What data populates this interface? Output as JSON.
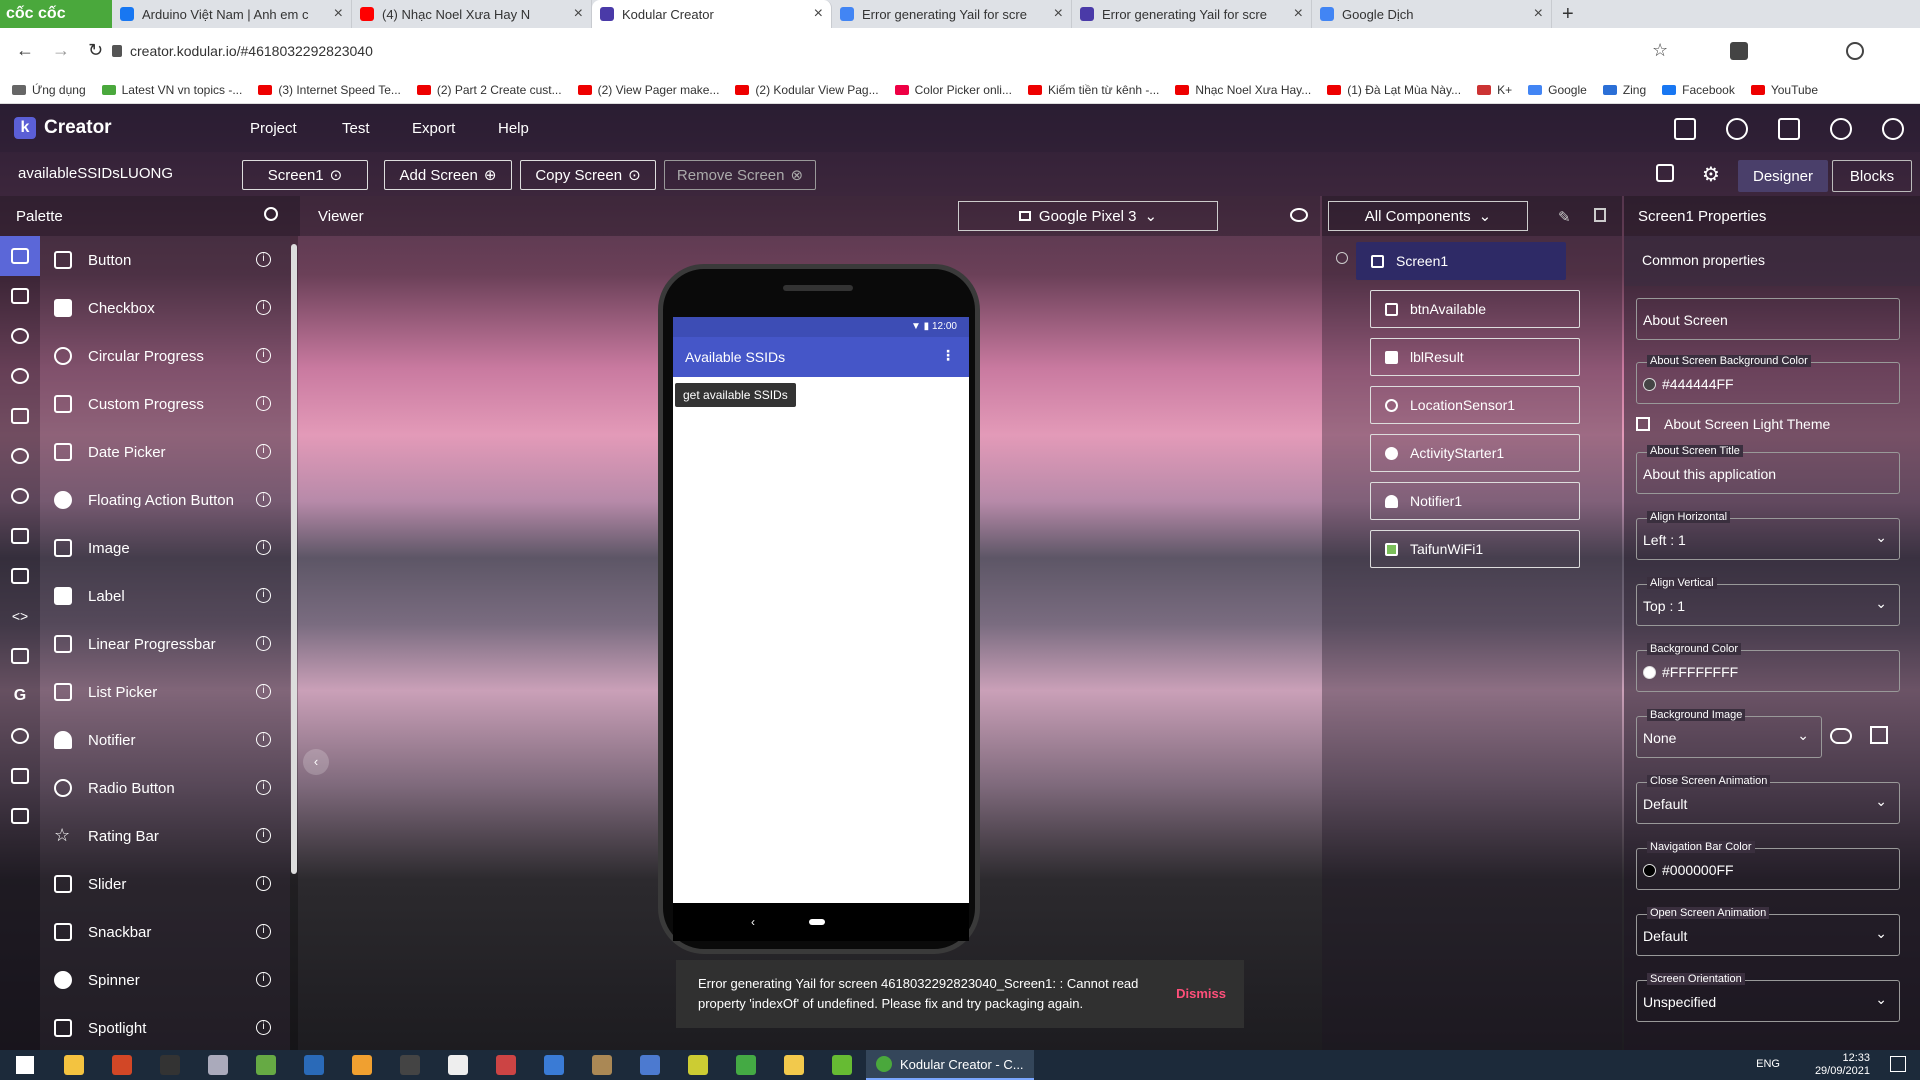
{
  "browser": {
    "brand": "cốc cốc",
    "tabs": [
      {
        "title": "Arduino Việt Nam | Anh em c",
        "favicon_color": "#1877f2"
      },
      {
        "title": "(4) Nhạc Noel Xưa Hay N",
        "favicon_color": "#ff0000"
      },
      {
        "title": "Kodular Creator",
        "favicon_color": "#4a3aa8"
      },
      {
        "title": "Error generating Yail for scre",
        "favicon_color": "#4285f4"
      },
      {
        "title": "Error generating Yail for scre",
        "favicon_color": "#4a3aa8"
      },
      {
        "title": "Google Dịch",
        "favicon_color": "#4285f4"
      }
    ],
    "url": "creator.kodular.io/#4618032292823040",
    "bookmarks": [
      "Ứng dụng",
      "Latest VN vn topics -...",
      "(3) Internet Speed Te...",
      "(2) Part 2 Create cust...",
      "(2) View Pager make...",
      "(2) Kodular View Pag...",
      "Color Picker onli...",
      "Kiếm tiền từ kênh -...",
      "Nhạc Noel Xưa Hay...",
      "(1) Đà Lạt Mùa Này...",
      "K+",
      "Google",
      "Zing",
      "Facebook",
      "YouTube"
    ]
  },
  "app": {
    "logo": "Creator",
    "menu": [
      "Project",
      "Test",
      "Export",
      "Help"
    ],
    "project_name": "availableSSIDsLUONG",
    "screen_select": "Screen1",
    "add_screen": "Add Screen",
    "copy_screen": "Copy Screen",
    "remove_screen": "Remove Screen",
    "designer": "Designer",
    "blocks": "Blocks"
  },
  "palette": {
    "title": "Palette",
    "items": [
      "Button",
      "Checkbox",
      "Circular Progress",
      "Custom Progress",
      "Date Picker",
      "Floating Action Button",
      "Image",
      "Label",
      "Linear Progressbar",
      "List Picker",
      "Notifier",
      "Radio Button",
      "Rating Bar",
      "Slider",
      "Snackbar",
      "Spinner",
      "Spotlight"
    ]
  },
  "viewer": {
    "title": "Viewer",
    "device": "Google Pixel 3",
    "status_time": "12:00",
    "app_title": "Available SSIDs",
    "button_text": "get available SSIDs"
  },
  "components": {
    "filter": "All Components",
    "root": "Screen1",
    "children": [
      "btnAvailable",
      "lblResult",
      "LocationSensor1",
      "ActivityStarter1",
      "Notifier1",
      "TaifunWiFi1"
    ]
  },
  "properties": {
    "title": "Screen1 Properties",
    "section": "Common properties",
    "about_screen": "About Screen",
    "fields": [
      {
        "label": "About Screen Background Color",
        "value": "#444444FF",
        "swatch": "#444444"
      },
      {
        "label": "About Screen Title",
        "value": "About this application"
      },
      {
        "label": "Align Horizontal",
        "value": "Left : 1"
      },
      {
        "label": "Align Vertical",
        "value": "Top : 1"
      },
      {
        "label": "Background Color",
        "value": "#FFFFFFFF",
        "swatch": "#ffffff"
      },
      {
        "label": "Background Image",
        "value": "None"
      },
      {
        "label": "Close Screen Animation",
        "value": "Default"
      },
      {
        "label": "Navigation Bar Color",
        "value": "#000000FF",
        "swatch": "#000000"
      },
      {
        "label": "Open Screen Animation",
        "value": "Default"
      },
      {
        "label": "Screen Orientation",
        "value": "Unspecified"
      }
    ],
    "light_theme": "About Screen Light Theme"
  },
  "snackbar": {
    "message": "Error generating Yail for screen 4618032292823040_Screen1: : Cannot read property 'indexOf' of undefined. Please fix and try packaging again.",
    "dismiss": "Dismiss"
  },
  "taskbar": {
    "active_app": "Kodular Creator - C...",
    "lang": "ENG",
    "time": "12:33",
    "date": "29/09/2021"
  }
}
